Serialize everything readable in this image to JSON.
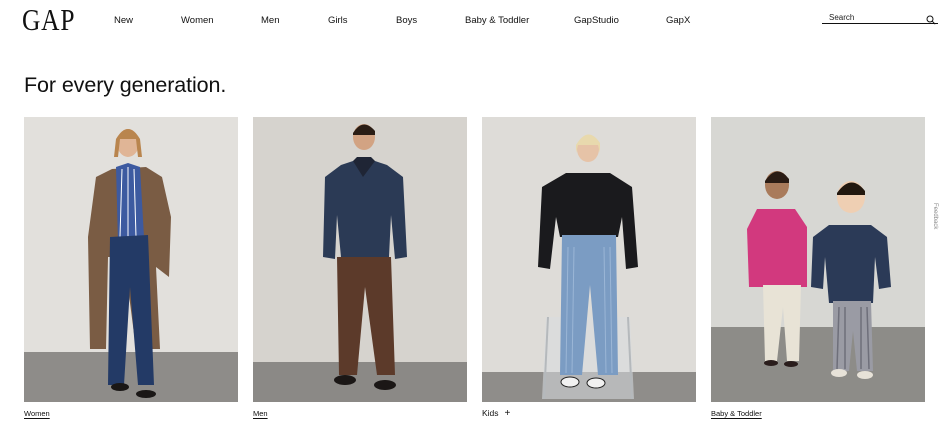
{
  "header": {
    "logo": "GAP",
    "nav": [
      {
        "label": "New"
      },
      {
        "label": "Women"
      },
      {
        "label": "Men"
      },
      {
        "label": "Girls"
      },
      {
        "label": "Boys"
      },
      {
        "label": "Baby & Toddler"
      },
      {
        "label": "GapStudio"
      },
      {
        "label": "GapX"
      }
    ],
    "search": {
      "placeholder": "Search",
      "icon": "search-icon"
    }
  },
  "main": {
    "heading": "For every generation.",
    "cards": [
      {
        "label": "Women",
        "image": "women-model-photo"
      },
      {
        "label": "Men",
        "image": "men-model-photo"
      },
      {
        "label": "Kids",
        "image": "kids-model-photo",
        "expand_icon": "+"
      },
      {
        "label": "Baby & Toddler",
        "image": "baby-toddler-models-photo"
      }
    ]
  },
  "feedback_tab": "Feedback"
}
